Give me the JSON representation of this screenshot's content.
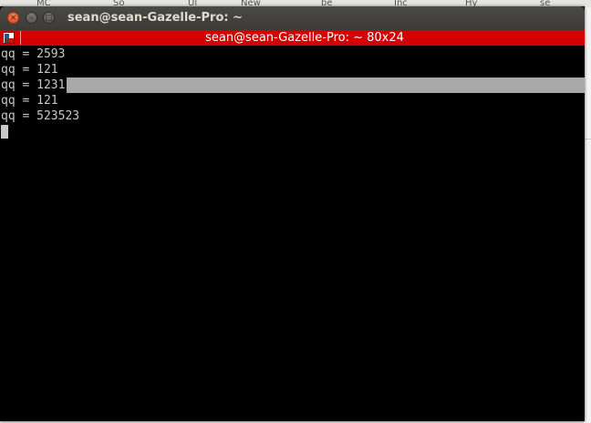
{
  "background_tabs": [
    {
      "label": "MC"
    },
    {
      "label": "So"
    },
    {
      "label": "Ul"
    },
    {
      "label": "New"
    },
    {
      "label": "be"
    },
    {
      "label": "Inc"
    },
    {
      "label": "Hy"
    },
    {
      "label": "se"
    }
  ],
  "window": {
    "title": "sean@sean-Gazelle-Pro: ~",
    "close_glyph": "×",
    "minimize_glyph": "–",
    "maximize_glyph": "□"
  },
  "terminal": {
    "title": "sean@sean-Gazelle-Pro: ~ 80x24",
    "lines": [
      "qq = 2593",
      "qq = 121",
      "qq = 1231",
      "qq = 121",
      "qq = 523523"
    ],
    "selected_line_index": 2
  },
  "colors": {
    "titlebar": "#3c3b37",
    "terminal_bar": "#d40000",
    "terminal_bg": "#000000",
    "terminal_text": "#c8c8c8",
    "selection": "#a8a8a8"
  },
  "icons": {
    "close": "close-icon",
    "minimize": "minimize-icon",
    "maximize": "maximize-icon",
    "terminal_menu": "terminal-menu-icon"
  }
}
